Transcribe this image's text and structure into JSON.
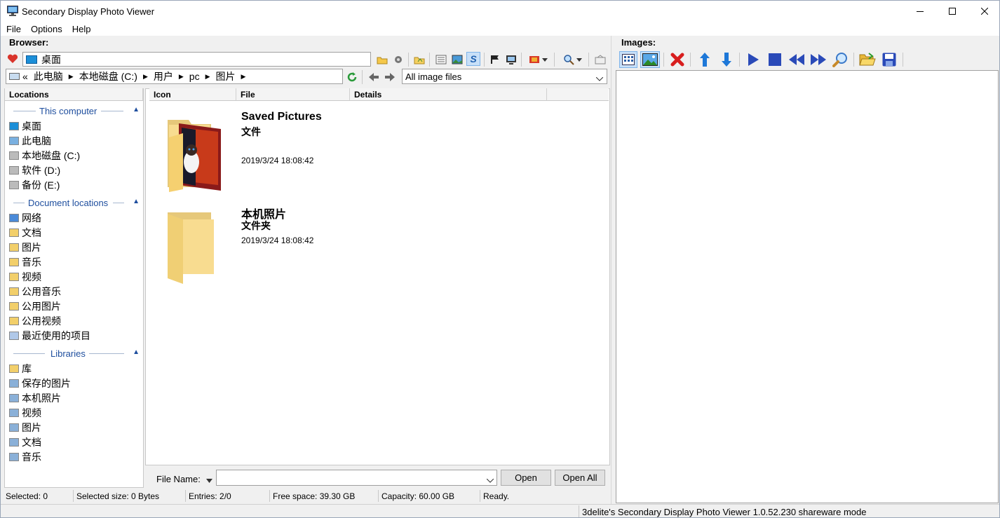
{
  "window": {
    "title": "Secondary Display Photo Viewer"
  },
  "menu": [
    "File",
    "Options",
    "Help"
  ],
  "browser": {
    "label": "Browser:",
    "location": "桌面",
    "breadcrumb": [
      "«",
      "此电脑",
      "本地磁盘 (C:)",
      "用户",
      "pc",
      "图片"
    ],
    "filter": "All image files"
  },
  "images": {
    "label": "Images:"
  },
  "locations": {
    "header": "Locations",
    "groups": {
      "computer": "This computer",
      "documents": "Document locations",
      "libraries": "Libraries"
    },
    "computer_items": [
      "桌面",
      "此电脑",
      "本地磁盘 (C:)",
      "软件 (D:)",
      "备份 (E:)"
    ],
    "document_items": [
      "网络",
      "文档",
      "图片",
      "音乐",
      "视频",
      "公用音乐",
      "公用图片",
      "公用视频",
      "最近使用的项目"
    ],
    "library_items": [
      "库",
      "保存的图片",
      "本机照片",
      "视频",
      "图片",
      "文档",
      "音乐"
    ]
  },
  "columns": {
    "icon": "Icon",
    "file": "File",
    "details": "Details"
  },
  "entries": [
    {
      "name": "Saved Pictures",
      "type": "文件",
      "date": "2019/3/24 18:08:42"
    },
    {
      "name": "本机照片",
      "type": "文件夹",
      "date": "2019/3/24 18:08:42"
    }
  ],
  "file_name": {
    "label": "File Name:",
    "value": "",
    "open": "Open",
    "open_all": "Open All"
  },
  "status": {
    "selected": "Selected: 0",
    "selected_size": "Selected size: 0 Bytes",
    "entries": "Entries: 2/0",
    "free_space": "Free space: 39.30 GB",
    "capacity": "Capacity: 60.00 GB",
    "ready": "Ready."
  },
  "footer": "3delite's Secondary Display Photo Viewer 1.0.52.230 shareware mode"
}
